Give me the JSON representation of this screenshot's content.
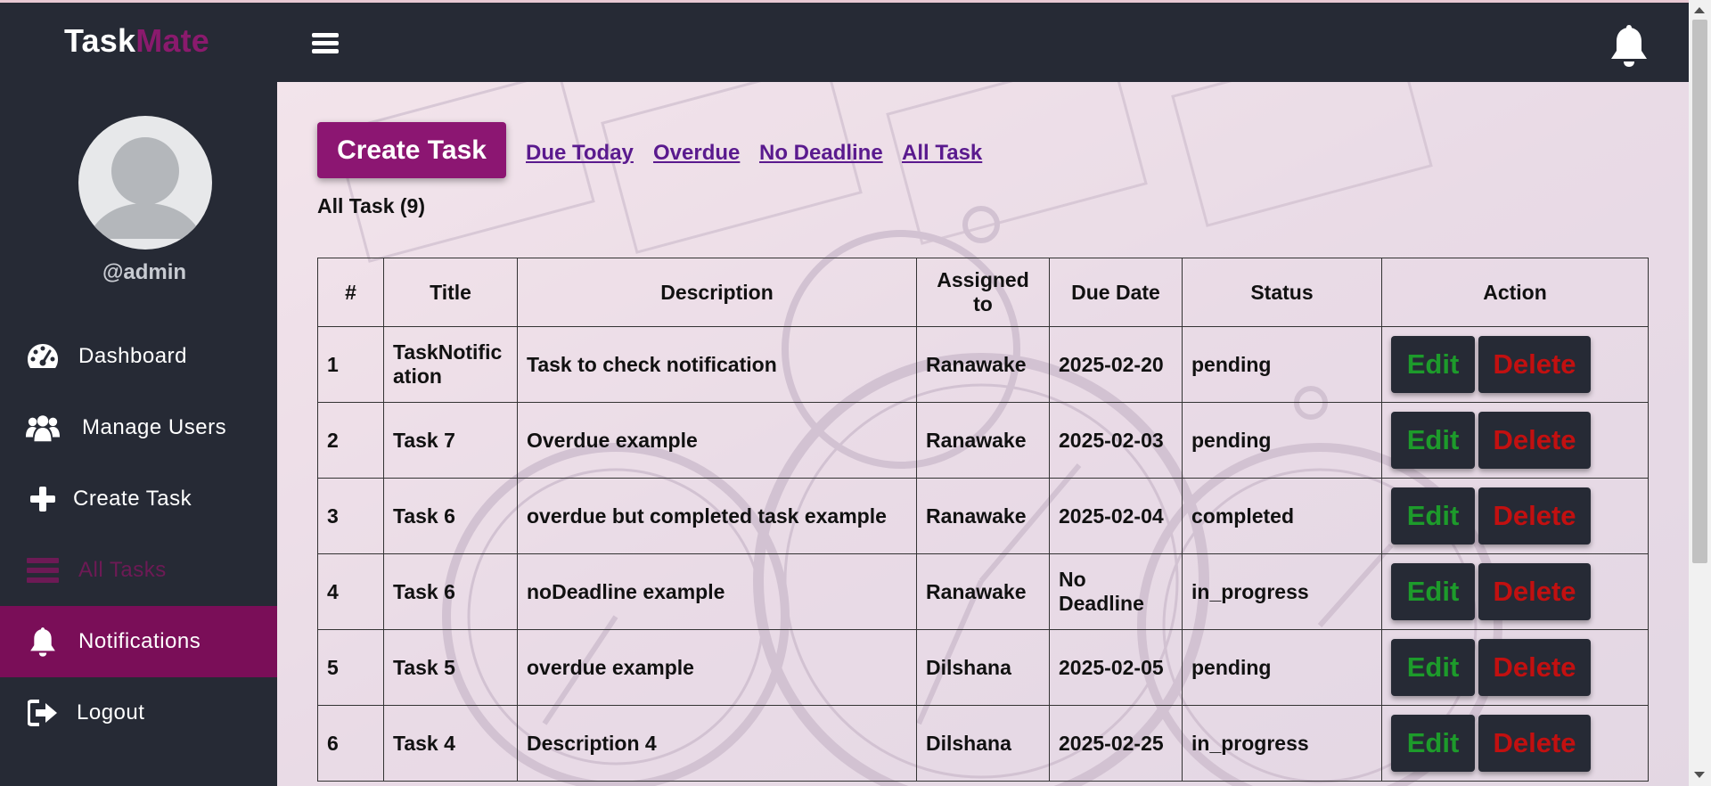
{
  "app": {
    "logo_part1": "Task",
    "logo_part2": "Mate",
    "brand_color": "#8a1a6d",
    "header_bg": "#262a35"
  },
  "header": {
    "menu_icon": "hamburger-icon",
    "bell_icon": "bell-icon"
  },
  "sidebar": {
    "username": "@admin",
    "items": [
      {
        "label": "Dashboard",
        "icon": "gauge-icon"
      },
      {
        "label": "Manage Users",
        "icon": "users-icon"
      },
      {
        "label": "Create Task",
        "icon": "plus-icon"
      },
      {
        "label": "All Tasks",
        "icon": "list-icon"
      },
      {
        "label": "Notifications",
        "icon": "bell-icon"
      },
      {
        "label": "Logout",
        "icon": "logout-icon"
      }
    ]
  },
  "main": {
    "create_button": "Create Task",
    "filters": [
      "Due Today",
      "Overdue",
      "No Deadline",
      "All Task"
    ],
    "count_label": "All Task (9)",
    "table": {
      "headers": [
        "#",
        "Title",
        "Description",
        "Assigned to",
        "Due Date",
        "Status",
        "Action"
      ],
      "rows": [
        {
          "num": "1",
          "title": "TaskNotification",
          "description": "Task to check notification",
          "assigned": "Ranawake",
          "due": "2025-02-20",
          "status": "pending"
        },
        {
          "num": "2",
          "title": "Task 7",
          "description": "Overdue example",
          "assigned": "Ranawake",
          "due": "2025-02-03",
          "status": "pending"
        },
        {
          "num": "3",
          "title": "Task 6",
          "description": "overdue but completed task example",
          "assigned": "Ranawake",
          "due": "2025-02-04",
          "status": "completed"
        },
        {
          "num": "4",
          "title": "Task 6",
          "description": "noDeadline example",
          "assigned": "Ranawake",
          "due": "No Deadline",
          "status": "in_progress"
        },
        {
          "num": "5",
          "title": "Task 5",
          "description": "overdue example",
          "assigned": "Dilshana",
          "due": "2025-02-05",
          "status": "pending"
        },
        {
          "num": "6",
          "title": "Task 4",
          "description": "Description 4",
          "assigned": "Dilshana",
          "due": "2025-02-25",
          "status": "in_progress"
        }
      ],
      "edit_label": "Edit",
      "delete_label": "Delete",
      "edit_color": "#1d9b2b",
      "delete_color": "#c21010"
    }
  }
}
